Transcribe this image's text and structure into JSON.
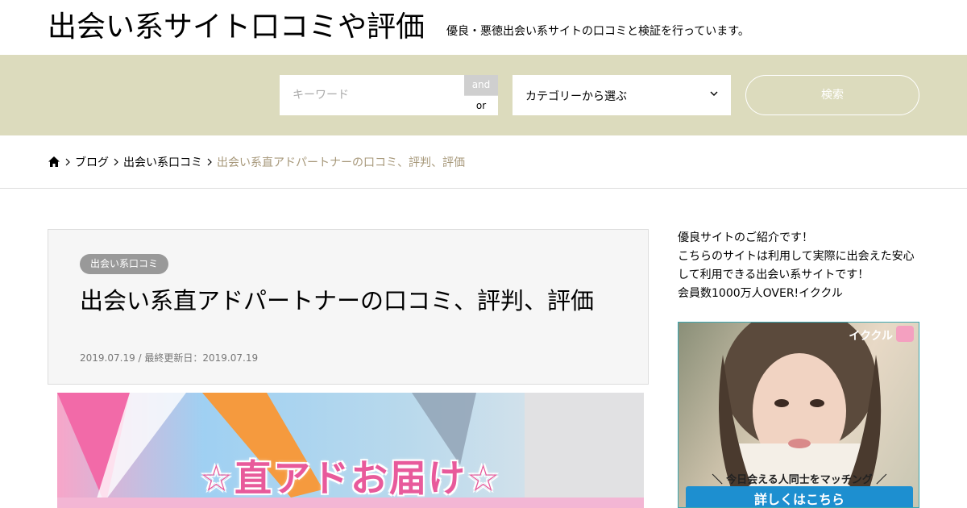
{
  "header": {
    "site_title": "出会い系サイト口コミや評価",
    "site_description": "優良・悪徳出会い系サイトの口コミと検証を行っています。"
  },
  "search": {
    "keyword_placeholder": "キーワード",
    "and_label": "and",
    "or_label": "or",
    "category_selected": "カテゴリーから選ぶ",
    "submit_label": "検索"
  },
  "breadcrumb": {
    "items": [
      "ブログ",
      "出会い系口コミ"
    ],
    "current": "出会い系直アドパートナーの口コミ、評判、評価"
  },
  "article": {
    "category": "出会い系口コミ",
    "title": "出会い系直アドパートナーの口コミ、評判、評価",
    "date": "2019.07.19 / 最終更新日：2019.07.19",
    "eyecatch_text": "☆直アドお届け☆"
  },
  "sidebar": {
    "intro_lines": [
      "優良サイトのご紹介です！",
      "こちらのサイトは利用して実際に出会えた安心",
      "して利用できる出会い系サイトです！",
      "会員数1000万人OVER!イククル"
    ],
    "banner": {
      "logo": "イククル",
      "tagline": "＼ 今日会える人同士をマッチング ／",
      "cta": "詳しくはこちら"
    }
  },
  "colors": {
    "search_band": "#dcdbbd",
    "breadcrumb_current": "#a7987a",
    "badge": "#999999",
    "cta": "#1d8fd0"
  }
}
